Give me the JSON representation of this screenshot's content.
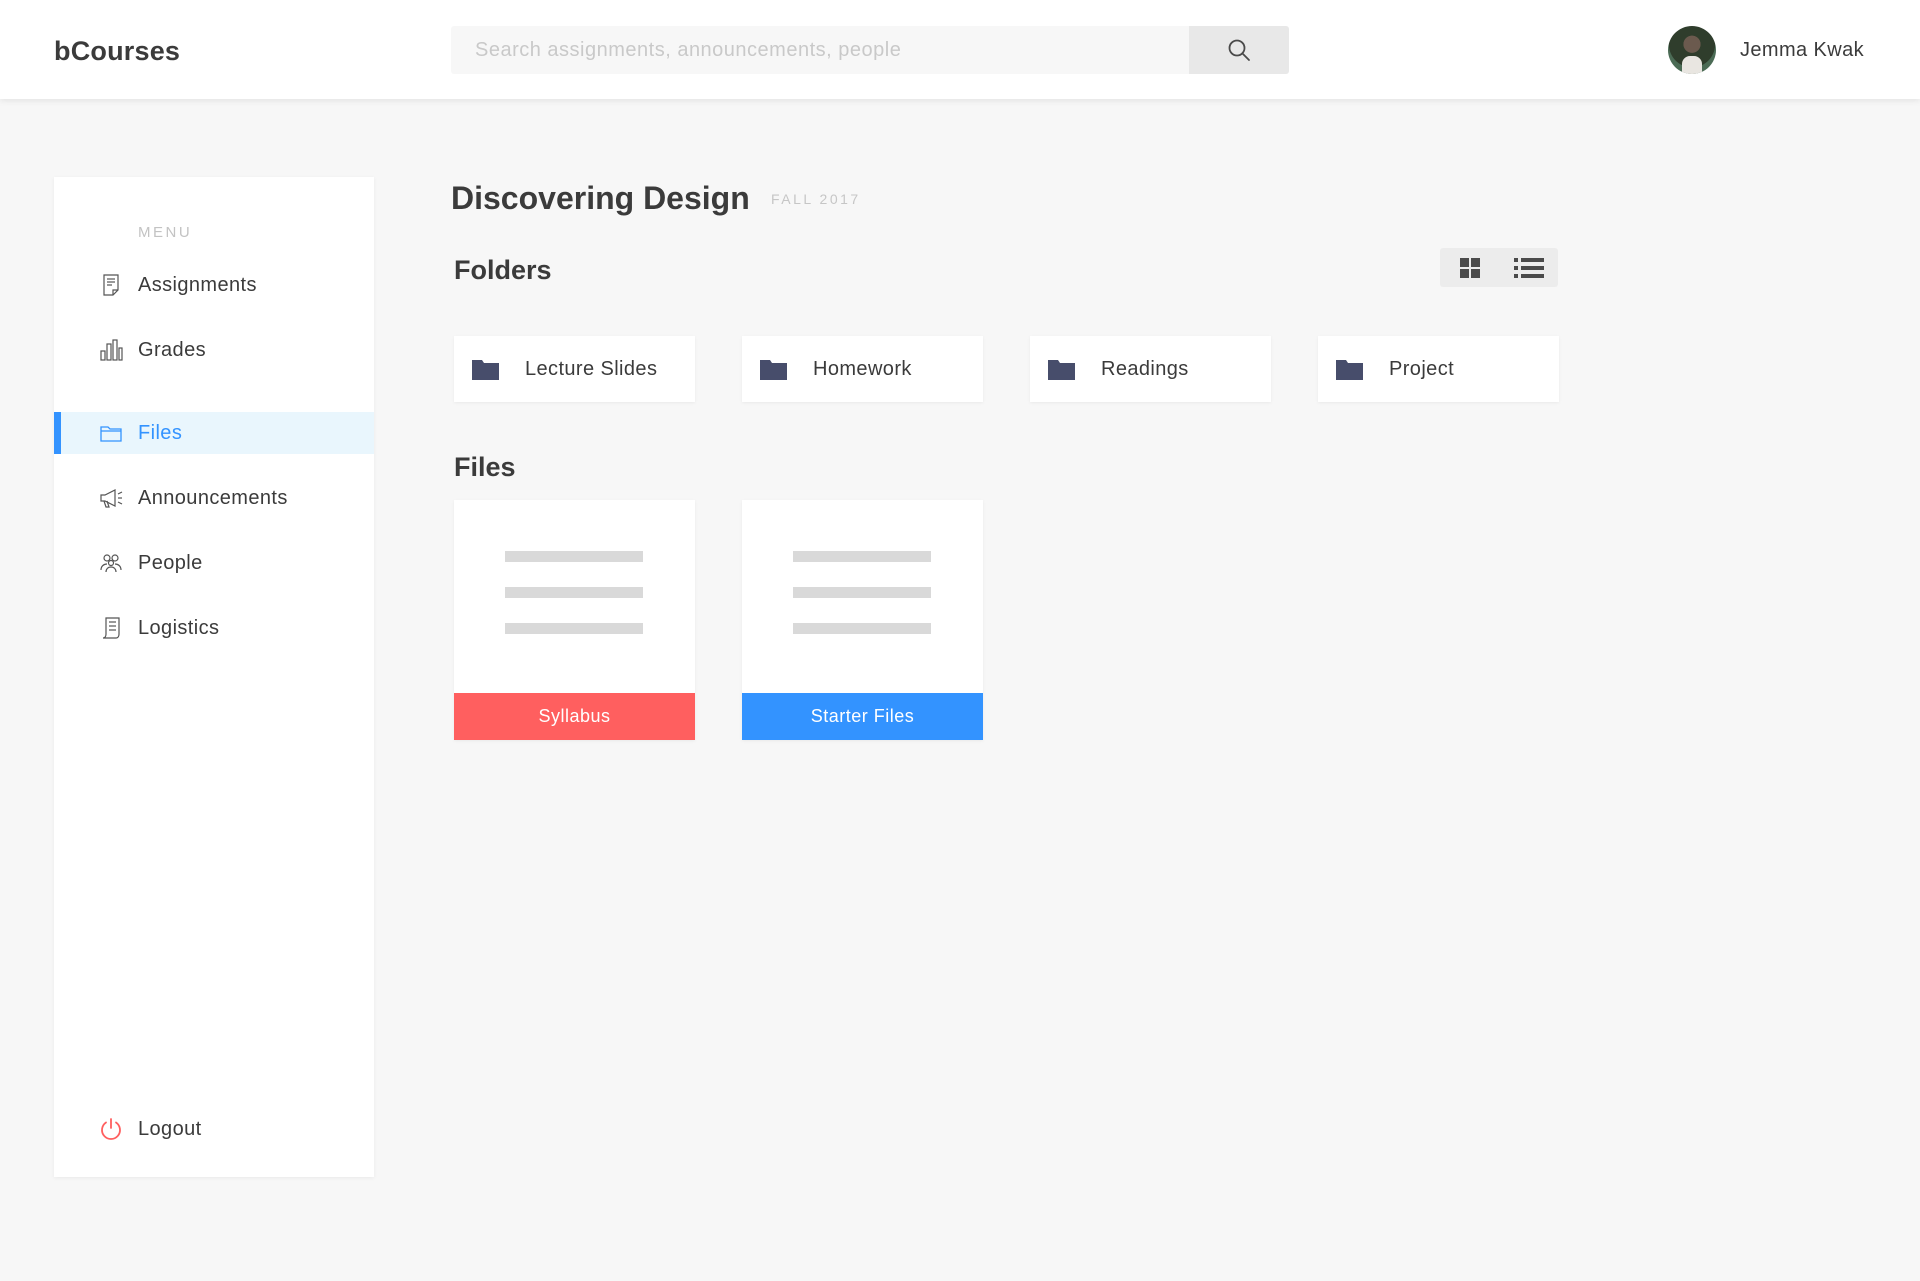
{
  "app": {
    "name": "bCourses"
  },
  "search": {
    "placeholder": "Search assignments, announcements, people"
  },
  "user": {
    "name": "Jemma Kwak"
  },
  "sidebar": {
    "title": "MENU",
    "items": [
      {
        "label": "Assignments",
        "icon": "assignment-icon"
      },
      {
        "label": "Grades",
        "icon": "bar-chart-icon"
      },
      {
        "label": "Files",
        "icon": "folder-outline-icon",
        "active": true
      },
      {
        "label": "Announcements",
        "icon": "megaphone-icon"
      },
      {
        "label": "People",
        "icon": "people-icon"
      },
      {
        "label": "Logistics",
        "icon": "document-icon"
      }
    ],
    "logout": {
      "label": "Logout",
      "icon": "power-icon"
    }
  },
  "course": {
    "title": "Discovering Design",
    "term": "FALL 2017"
  },
  "folders_section": {
    "title": "Folders"
  },
  "folders": [
    {
      "label": "Lecture Slides"
    },
    {
      "label": "Homework"
    },
    {
      "label": "Readings"
    },
    {
      "label": "Project"
    }
  ],
  "files_section": {
    "title": "Files"
  },
  "files": [
    {
      "label": "Syllabus",
      "color": "#ff5f5f"
    },
    {
      "label": "Starter Files",
      "color": "#3393ff"
    }
  ],
  "colors": {
    "accent": "#3393ff",
    "folder_icon": "#474d6b",
    "logout_icon": "#ff5f5f"
  }
}
